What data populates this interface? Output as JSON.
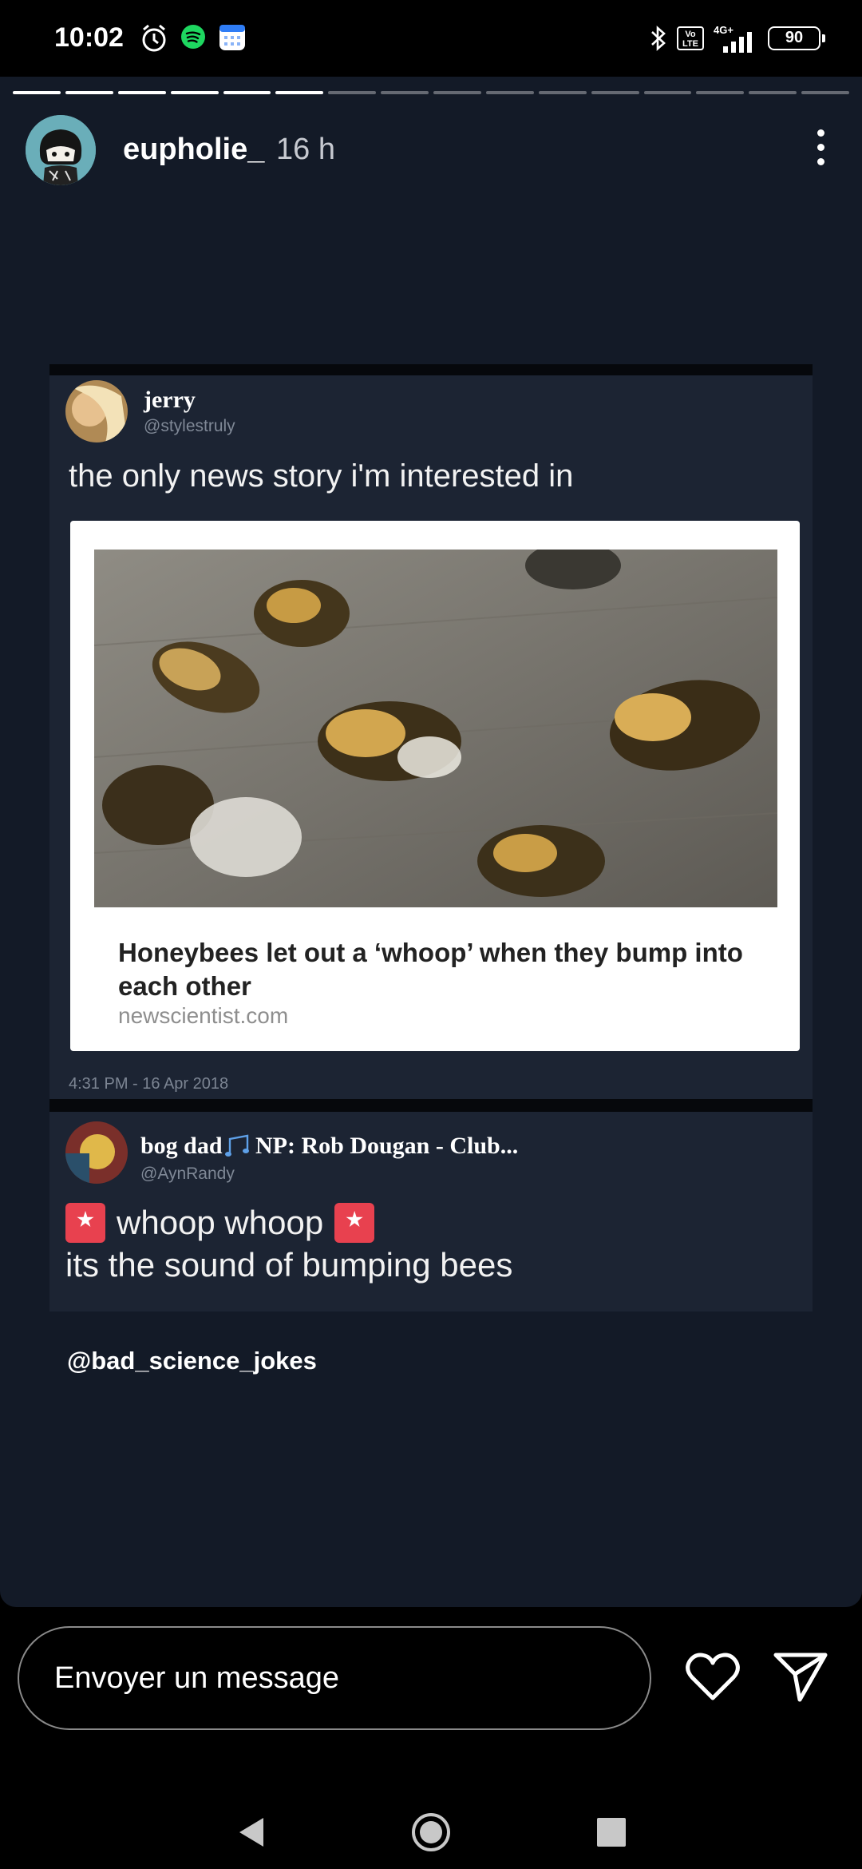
{
  "status_bar": {
    "time": "10:02",
    "battery": "90",
    "network": "4G+",
    "volte": "Vo LTE",
    "icons": [
      "alarm-icon",
      "spotify-icon",
      "calendar-icon",
      "bluetooth-icon",
      "volte-icon",
      "signal-icon",
      "battery-icon"
    ]
  },
  "story": {
    "progress_total": 16,
    "progress_done": 6,
    "username": "eupholie_",
    "time_ago": "16 h",
    "background": "#131a27"
  },
  "tweet1": {
    "name": "jerry",
    "handle": "@stylestruly",
    "text": "the only news story i'm interested in",
    "news_title": "Honeybees let out a ‘whoop’ when they bump into each other",
    "news_source": "newscientist.com",
    "date": "4:31 PM - 16 Apr 2018"
  },
  "tweet2": {
    "name": "bog dad",
    "now_playing": "NP: Rob Dougan - Club...",
    "handle": "@AynRandy",
    "line1": "whoop whoop",
    "line2": "its the sound of bumping bees"
  },
  "mention": "@bad_science_jokes",
  "reply": {
    "placeholder": "Envoyer un message"
  },
  "colors": {
    "story_bg": "#131a27",
    "tweet_bg": "#1c2433",
    "siren": "#e8414f"
  }
}
